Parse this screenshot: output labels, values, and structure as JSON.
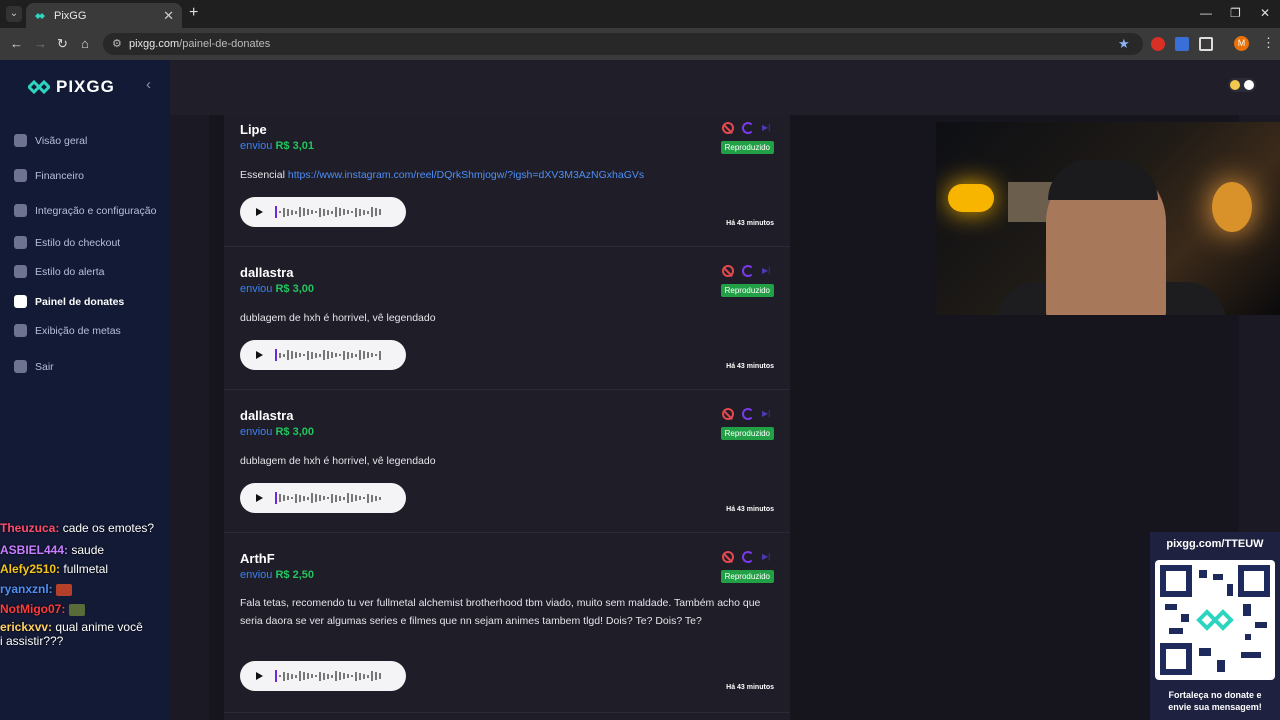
{
  "browser": {
    "tab_title": "PixGG",
    "url_domain": "pixgg.com",
    "url_path": "/painel-de-donates"
  },
  "sidebar": {
    "logo": "PIXGG",
    "items": [
      {
        "label": "Visão geral",
        "icon": "home-icon"
      },
      {
        "label": "Financeiro",
        "icon": "wallet-icon"
      },
      {
        "label": "Integração e configuração",
        "icon": "settings-icon"
      },
      {
        "label": "Estilo do checkout",
        "icon": "palette-icon"
      },
      {
        "label": "Estilo do alerta",
        "icon": "palette-icon"
      },
      {
        "label": "Painel de donates",
        "icon": "donate-icon",
        "active": true
      },
      {
        "label": "Exibição de metas",
        "icon": "star-icon"
      },
      {
        "label": "Sair",
        "icon": "logout-icon"
      }
    ]
  },
  "donations": [
    {
      "name": "Lipe",
      "sent_label": "enviou",
      "amount": "R$ 3,01",
      "status": "Reproduzido",
      "message": "Essencial",
      "link": "https://www.instagram.com/reel/DQrkShmjogw/?igsh=dXV3M3AzNGxhaGVs",
      "time": "Há 43 minutos"
    },
    {
      "name": "dallastra",
      "sent_label": "enviou",
      "amount": "R$ 3,00",
      "status": "Reproduzido",
      "message": "dublagem de hxh é horrivel, vê legendado",
      "time": "Há 43 minutos"
    },
    {
      "name": "dallastra",
      "sent_label": "enviou",
      "amount": "R$ 3,00",
      "status": "Reproduzido",
      "message": "dublagem de hxh é horrivel, vê legendado",
      "time": "Há 43 minutos"
    },
    {
      "name": "ArthF",
      "sent_label": "enviou",
      "amount": "R$ 2,50",
      "status": "Reproduzido",
      "message": "Fala tetas, recomendo tu ver fullmetal alchemist brotherhood tbm viado, muito sem maldade. Também acho que seria daora se ver algumas series e filmes que nn sejam animes tambem tlgd! Dois? Te? Dois? Te?",
      "time": "Há 43 minutos"
    }
  ],
  "chat": [
    {
      "user": "Theuzuca:",
      "text": "cade os emotes?",
      "color": "#ff4d6d"
    },
    {
      "user": "ASBIEL444:",
      "text": "saude",
      "color": "#c77dff"
    },
    {
      "user": "Alefy2510:",
      "text": "fullmetal",
      "color": "#f5c518"
    },
    {
      "user": "ryanxznl:",
      "text": "",
      "color": "#4d8ff7"
    },
    {
      "user": "NotMigo07:",
      "text": "",
      "color": "#ff3b3b"
    },
    {
      "user": "erickxvv:",
      "text": "qual anime você",
      "color": "#ffd166"
    },
    {
      "user": "",
      "text": "i assistir???",
      "color": "#ffffff"
    }
  ],
  "qr": {
    "title": "pixgg.com/TTEUW",
    "footer_1": "Fortaleça no donate e",
    "footer_2": "envie sua mensagem!"
  }
}
